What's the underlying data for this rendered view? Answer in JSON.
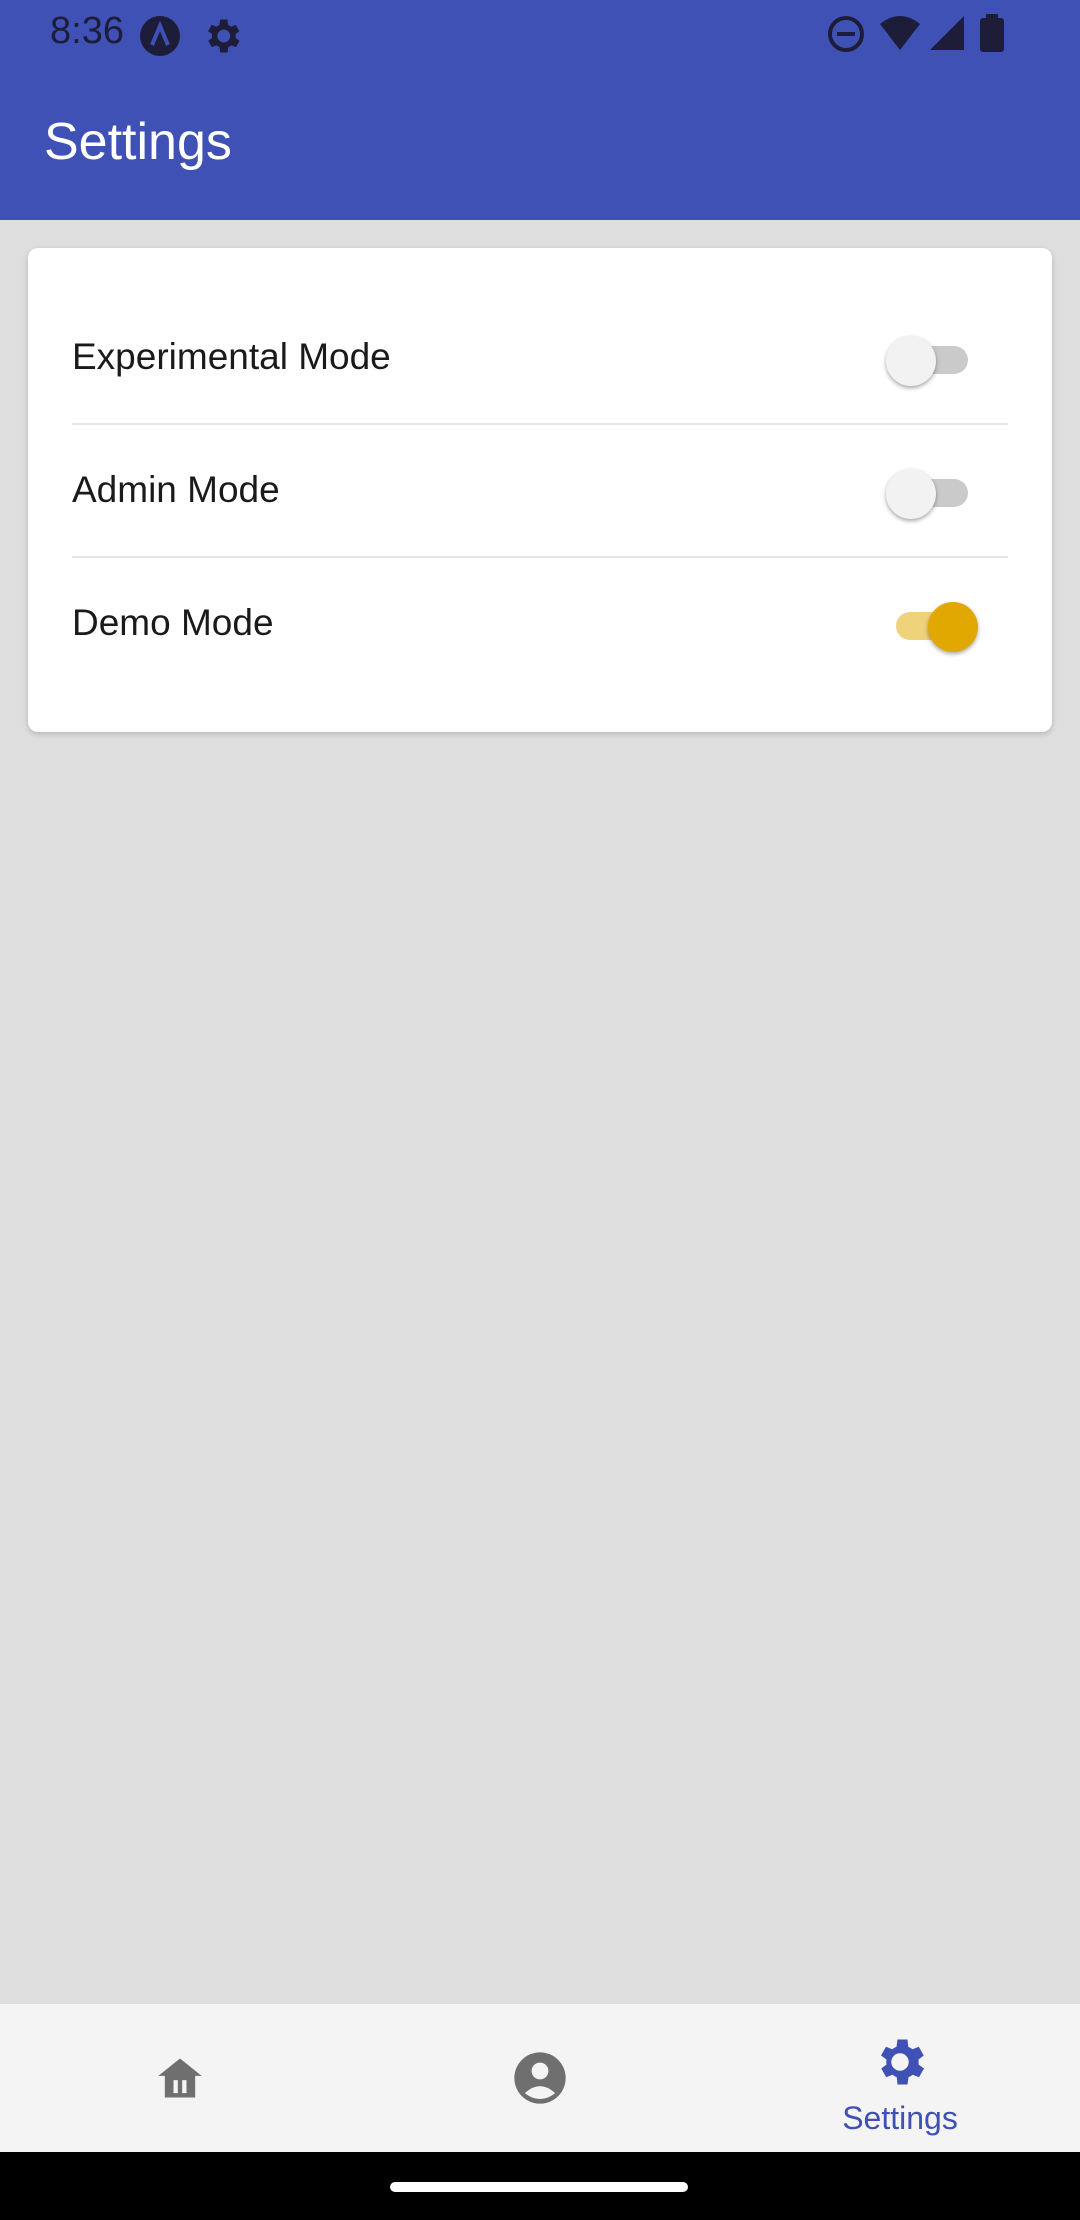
{
  "status_bar": {
    "time": "8:36",
    "icons": [
      "app-badge-icon",
      "settings-gear-icon",
      "do-not-disturb-icon",
      "wifi-icon",
      "signal-icon",
      "battery-icon"
    ]
  },
  "app_bar": {
    "title": "Settings",
    "color": "#4051b5"
  },
  "settings": {
    "items": [
      {
        "label": "Experimental Mode",
        "enabled": false
      },
      {
        "label": "Admin Mode",
        "enabled": false
      },
      {
        "label": "Demo Mode",
        "enabled": true
      }
    ],
    "switch_on_color": "#e0a800"
  },
  "bottom_nav": {
    "items": [
      {
        "icon": "home-icon",
        "label": ""
      },
      {
        "icon": "account-icon",
        "label": ""
      },
      {
        "icon": "settings-gear-icon",
        "label": "Settings",
        "active": true
      }
    ]
  }
}
